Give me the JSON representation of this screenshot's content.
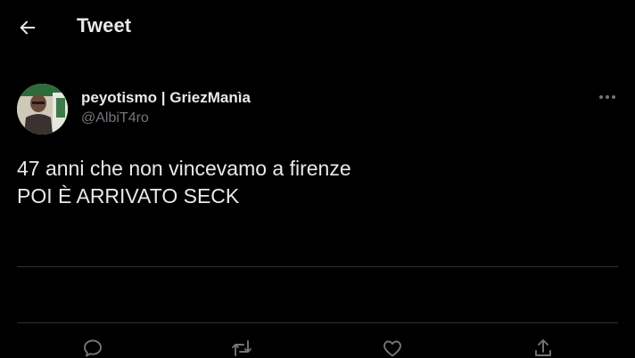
{
  "header": {
    "title": "Tweet",
    "back_icon": "arrow-left-icon"
  },
  "tweet": {
    "author": {
      "display_name": "peyotismo | GriezManìa",
      "handle": "@AlbiT4ro"
    },
    "text_lines": [
      "47 anni che non vincevamo a firenze",
      "POI È ARRIVATO SECK"
    ],
    "more_icon": "more-horizontal-icon"
  },
  "actions": [
    {
      "name": "reply",
      "icon": "reply-icon"
    },
    {
      "name": "retweet",
      "icon": "retweet-icon"
    },
    {
      "name": "like",
      "icon": "heart-icon"
    },
    {
      "name": "share",
      "icon": "share-icon"
    }
  ],
  "colors": {
    "background": "#000000",
    "primary_text": "#e7e9ea",
    "secondary_text": "#71767b",
    "divider": "#2f3336"
  }
}
